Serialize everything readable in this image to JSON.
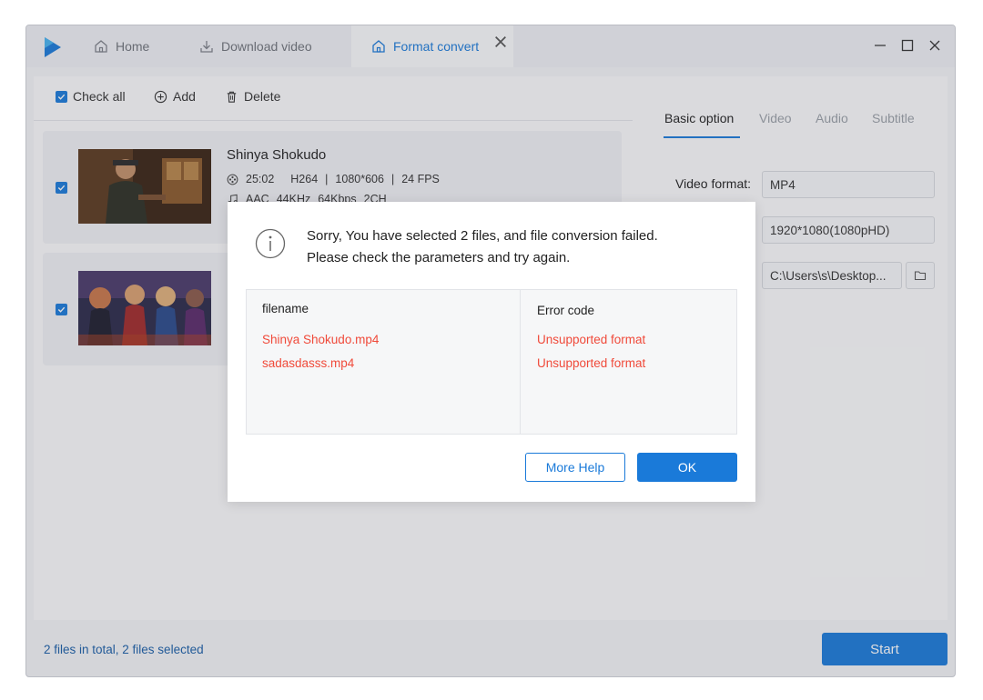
{
  "tabs": {
    "home": "Home",
    "download": "Download video",
    "convert": "Format convert"
  },
  "toolbar": {
    "check_all": "Check all",
    "add": "Add",
    "delete": "Delete"
  },
  "files": [
    {
      "title": "Shinya Shokudo",
      "duration": "25:02",
      "video_codec": "H264",
      "resolution": "1080*606",
      "fps": "24 FPS",
      "audio_codec": "AAC",
      "sample_rate": "44KHz",
      "bitrate": "64Kbps",
      "channels": "2CH",
      "checked": true
    },
    {
      "checked": true
    }
  ],
  "right": {
    "tabs": [
      "Basic option",
      "Video",
      "Audio",
      "Subtitle"
    ],
    "video_format_label": "Video format:",
    "video_format_value": "MP4",
    "resolution_value": "1920*1080(1080pHD)",
    "output_path": "C:\\Users\\s\\Desktop..."
  },
  "footer": {
    "summary": "2 files in total, 2 files selected",
    "start": "Start"
  },
  "dialog": {
    "line1": "Sorry, You have selected 2 files, and file conversion failed.",
    "line2": "Please check the parameters and try again.",
    "col_filename": "filename",
    "col_error": "Error code",
    "errors": [
      {
        "file": "Shinya Shokudo.mp4",
        "code": "Unsupported format"
      },
      {
        "file": "sadasdasss.mp4",
        "code": "Unsupported format"
      }
    ],
    "more_help": "More Help",
    "ok": "OK"
  },
  "colors": {
    "accent": "#1a7ad9",
    "error": "#f04a3a"
  },
  "icons": [
    "app-logo-icon",
    "home-icon",
    "download-icon",
    "close-icon",
    "minimize-icon",
    "maximize-icon",
    "add-icon",
    "delete-icon",
    "check-icon",
    "film-icon",
    "music-icon",
    "folder-icon",
    "info-icon"
  ]
}
